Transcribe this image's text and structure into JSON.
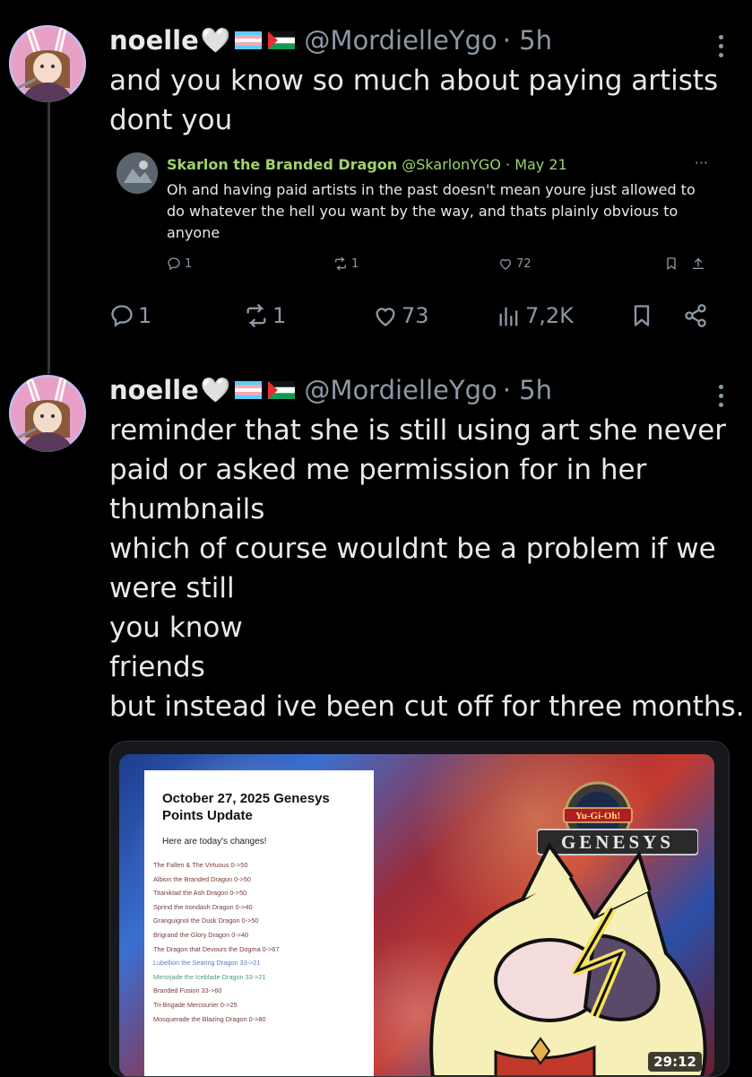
{
  "posts": [
    {
      "author_name": "noelle",
      "heart": "🤍",
      "handle": "@MordielleYgo",
      "time": "· 5h",
      "text_lines": [
        "and you know so much about paying artists",
        "dont you"
      ],
      "quote": {
        "author_name": "Skarlon the Branded Dragon",
        "handle": "@SkarlonYGO",
        "time": "· May 21",
        "text_lines": [
          "Oh and having paid artists in the past doesn't mean youre just allowed to",
          "do whatever the hell you want by the way, and thats plainly obvious to",
          "anyone"
        ],
        "replies": "1",
        "reposts": "1",
        "likes": "72",
        "more": "···"
      },
      "replies": "1",
      "reposts": "1",
      "likes": "73",
      "views": "7,2K"
    },
    {
      "author_name": "noelle",
      "heart": "🤍",
      "handle": "@MordielleYgo",
      "time": "· 5h",
      "text_lines": [
        "reminder that she is still using art she never",
        "paid or asked me permission for in her",
        "thumbnails",
        "which of course wouldnt be a problem if we",
        "were still",
        "you know",
        "friends",
        "but instead ive been cut off for three months."
      ],
      "video": {
        "notice_title_1": "October 27, 2025 Genesys",
        "notice_title_2": "Points Update",
        "notice_sub": "Here are today's changes!",
        "notice_items": [
          "The Fallen & The Virtuous 0->50",
          "Albion the Branded Dragon 0->50",
          "Titaniklad the Ash Dragon 0->50",
          "Sprind the Irondash Dragon 0->40",
          "Granguignol the Dusk Dragon 0->50",
          "Brigrand the Glory Dragon 0->40",
          "The Dragon that Devours the Dogma 0->67",
          "Lubellion the Searing Dragon 33->21",
          "Mirrorjade the Iceblade Dragon 33->21",
          "Branded Fusion 33->60",
          "Tri-Brigade Mercourier 0->25",
          "Mosquerade the Blazing Dragon 0->80"
        ],
        "logo_top": "Yu-Gi-Oh!",
        "logo_text": "GENESYS",
        "duration": "29:12"
      }
    }
  ],
  "colors": {
    "background": "#000000",
    "text": "#e7e9ea",
    "secondary": "#8b98a5",
    "quote_name": "#9fd36b"
  },
  "icons": [
    "reply-icon",
    "repost-icon",
    "like-icon",
    "views-icon",
    "bookmark-icon",
    "share-icon",
    "more-icon",
    "trans-flag-icon",
    "palestine-flag-icon"
  ]
}
